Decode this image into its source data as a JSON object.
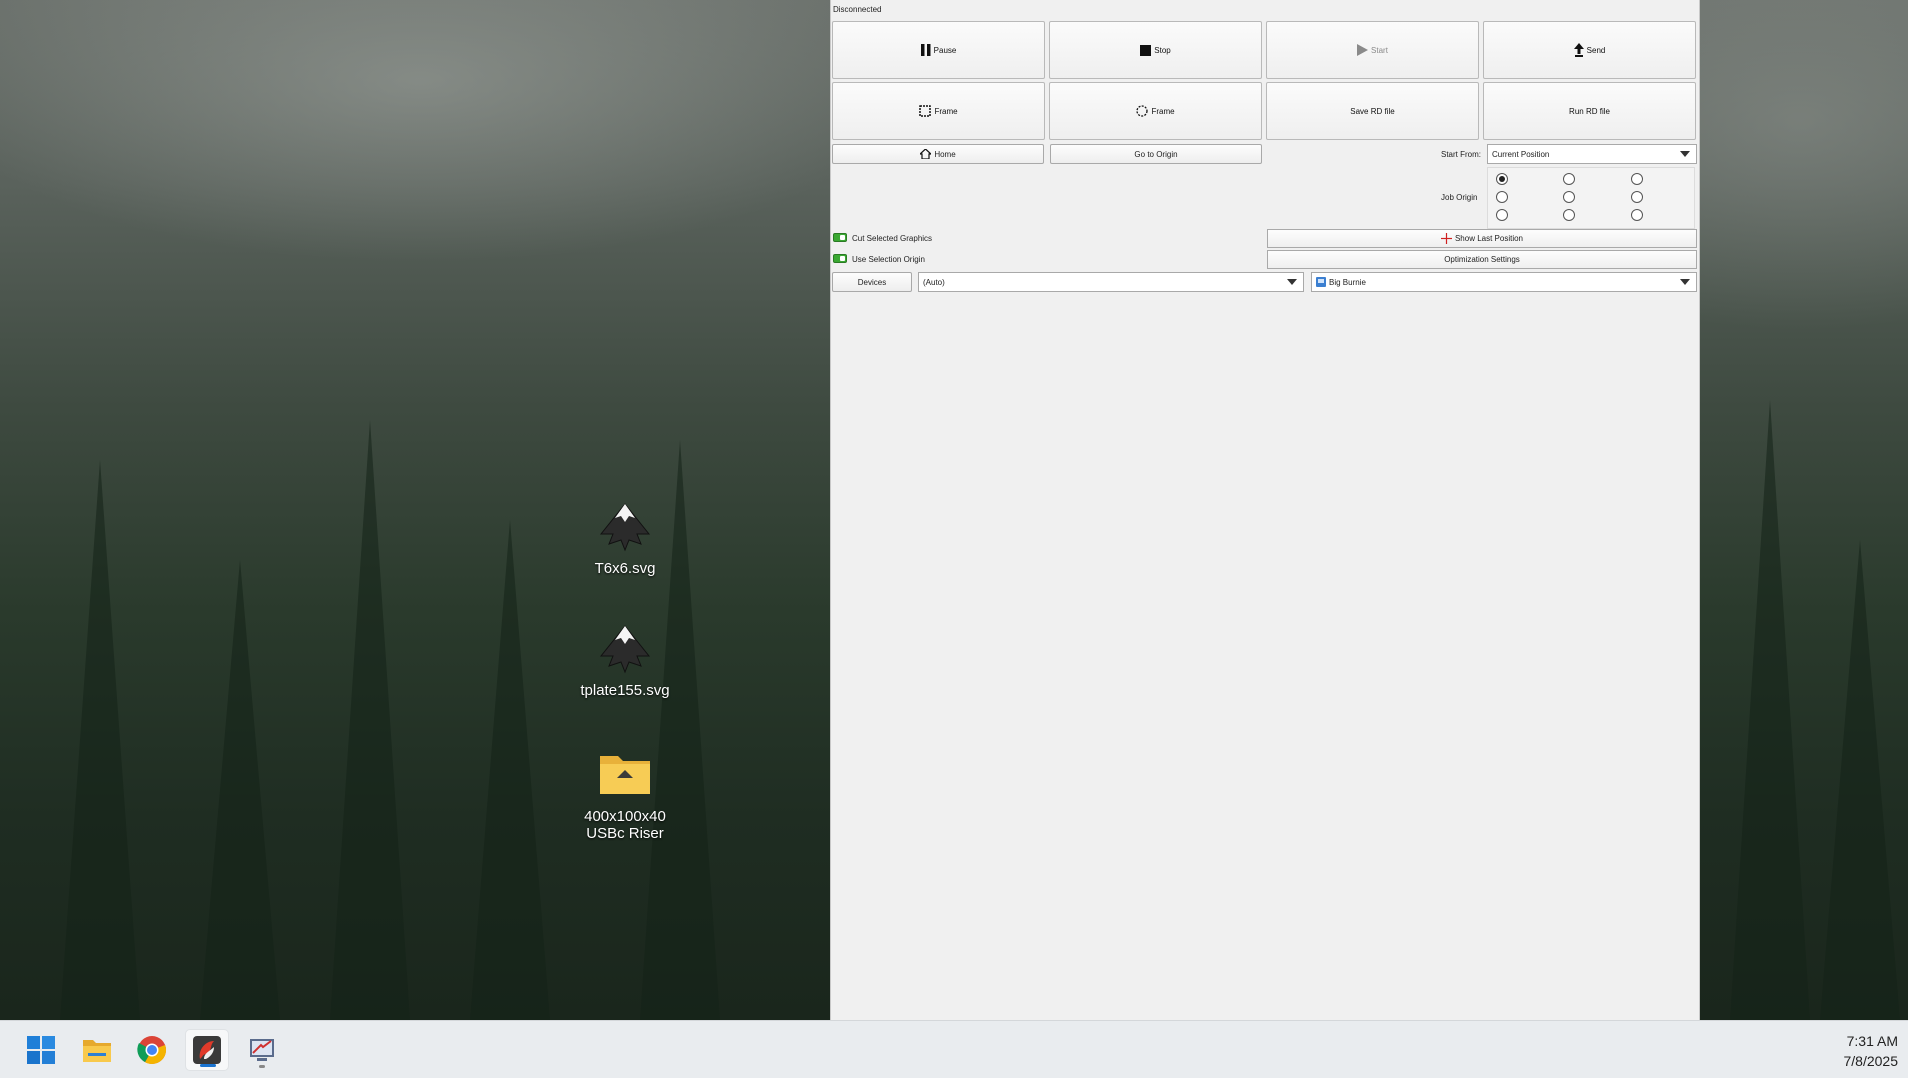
{
  "desktop": {
    "icons": [
      {
        "label": "T6x6.svg",
        "type": "inkscape-icon"
      },
      {
        "label": "tplate155.svg",
        "type": "inkscape-icon"
      },
      {
        "label": "400x100x40\nUSBc Riser",
        "type": "folder-icon"
      }
    ]
  },
  "app": {
    "status": "Disconnected",
    "buttons": {
      "pause": "Pause",
      "stop": "Stop",
      "start": "Start",
      "send": "Send",
      "frame_rect": "Frame",
      "frame_circle": "Frame",
      "save_rd": "Save RD file",
      "run_rd": "Run RD file",
      "home": "Home",
      "go_origin": "Go to Origin",
      "show_last_position": "Show Last Position",
      "optimization_settings": "Optimization Settings",
      "devices": "Devices"
    },
    "start_from": {
      "label": "Start From:",
      "value": "Current Position"
    },
    "job_origin": {
      "label": "Job Origin",
      "selected_index": 0
    },
    "checks": {
      "cut_selected_graphics": {
        "label": "Cut Selected Graphics",
        "on": true
      },
      "use_selection_origin": {
        "label": "Use Selection Origin",
        "on": true
      }
    },
    "port_combo": "(Auto)",
    "device_combo": "Big Burnie"
  },
  "taskbar": {
    "apps": [
      "windows-start-icon",
      "file-explorer-icon",
      "chrome-icon",
      "lightburn-icon",
      "app-icon"
    ],
    "time": "7:31 AM",
    "date": "7/8/2025"
  },
  "colors": {
    "accent": "#1a73d0",
    "toggle": "#3aa832"
  }
}
